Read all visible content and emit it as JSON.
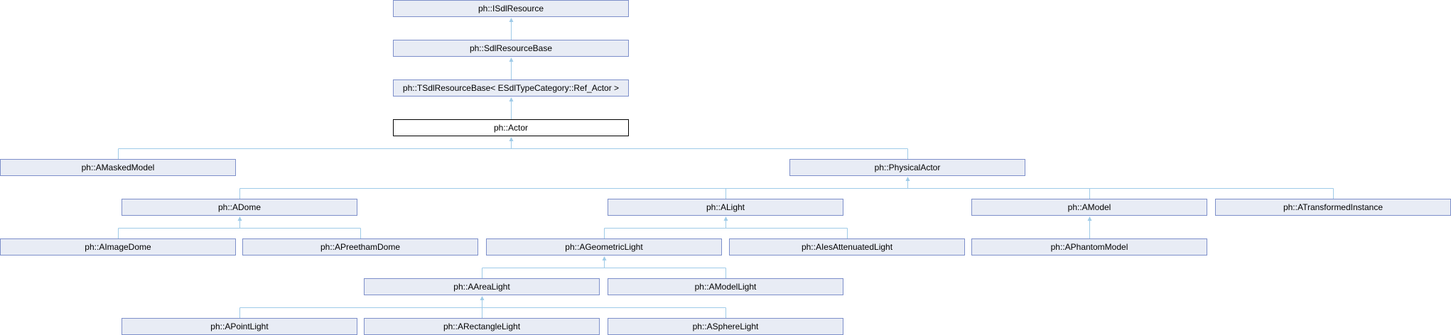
{
  "title": "Inheritance diagram for ph::Actor",
  "colors": {
    "node_fill": "#e8ecf5",
    "node_border": "#7d8fca",
    "edge": "#9fcbe8",
    "current_fill": "#ffffff"
  },
  "nodes": [
    {
      "id": "ISdlResource",
      "label": "ph::ISdlResource",
      "parent": null
    },
    {
      "id": "SdlResourceBase",
      "label": "ph::SdlResourceBase",
      "parent": "ISdlResource"
    },
    {
      "id": "TSdlResourceBase",
      "label": "ph::TSdlResourceBase< ESdlTypeCategory::Ref_Actor >",
      "parent": "SdlResourceBase"
    },
    {
      "id": "Actor",
      "label": "ph::Actor",
      "parent": "TSdlResourceBase",
      "current": true
    },
    {
      "id": "AMaskedModel",
      "label": "ph::AMaskedModel",
      "parent": "Actor"
    },
    {
      "id": "PhysicalActor",
      "label": "ph::PhysicalActor",
      "parent": "Actor"
    },
    {
      "id": "ADome",
      "label": "ph::ADome",
      "parent": "PhysicalActor"
    },
    {
      "id": "ALight",
      "label": "ph::ALight",
      "parent": "PhysicalActor"
    },
    {
      "id": "AModel",
      "label": "ph::AModel",
      "parent": "PhysicalActor"
    },
    {
      "id": "ATransformedInstance",
      "label": "ph::ATransformedInstance",
      "parent": "PhysicalActor"
    },
    {
      "id": "AImageDome",
      "label": "ph::AImageDome",
      "parent": "ADome"
    },
    {
      "id": "APreethamDome",
      "label": "ph::APreethamDome",
      "parent": "ADome"
    },
    {
      "id": "AGeometricLight",
      "label": "ph::AGeometricLight",
      "parent": "ALight"
    },
    {
      "id": "AIesAttenuatedLight",
      "label": "ph::AIesAttenuatedLight",
      "parent": "ALight"
    },
    {
      "id": "APhantomModel",
      "label": "ph::APhantomModel",
      "parent": "AModel"
    },
    {
      "id": "AAreaLight",
      "label": "ph::AAreaLight",
      "parent": "AGeometricLight"
    },
    {
      "id": "AModelLight",
      "label": "ph::AModelLight",
      "parent": "AGeometricLight"
    },
    {
      "id": "APointLight",
      "label": "ph::APointLight",
      "parent": "AAreaLight"
    },
    {
      "id": "ARectangleLight",
      "label": "ph::ARectangleLight",
      "parent": "AAreaLight"
    },
    {
      "id": "ASphereLight",
      "label": "ph::ASphereLight",
      "parent": "AAreaLight"
    }
  ]
}
